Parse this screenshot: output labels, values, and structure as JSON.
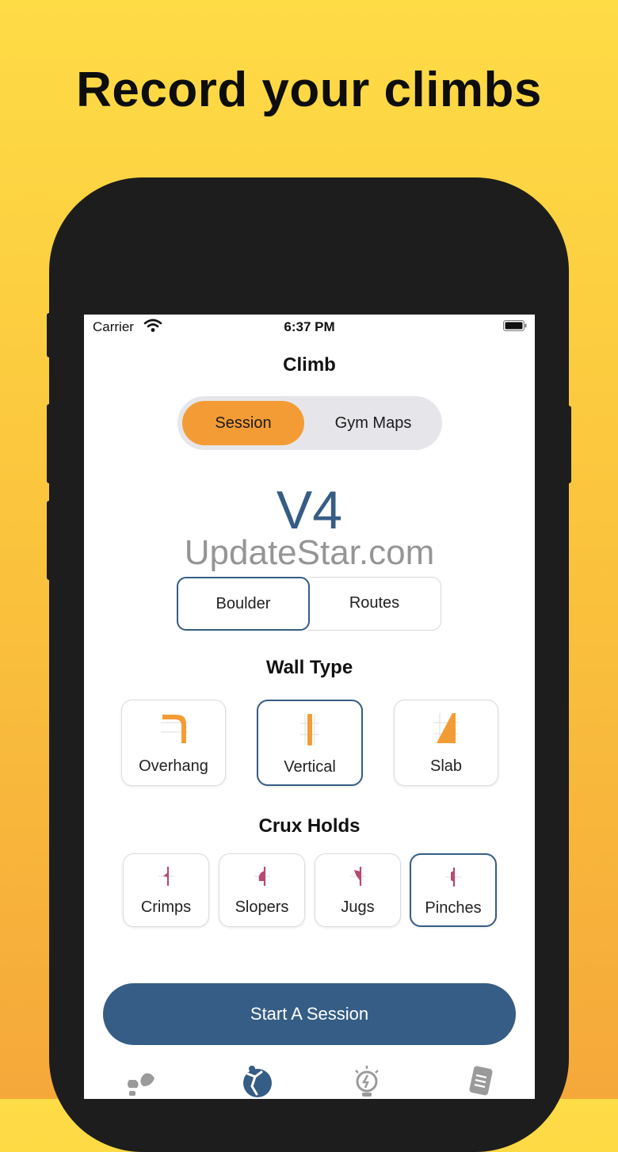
{
  "headline": "Record your climbs",
  "status_bar": {
    "carrier": "Carrier",
    "time": "6:37 PM"
  },
  "nav": {
    "title": "Climb"
  },
  "segment": {
    "options": [
      "Session",
      "Gym Maps"
    ],
    "selected": "Session"
  },
  "grade": "V4",
  "watermark": "UpdateStar.com",
  "climb_type": {
    "options": [
      "Boulder",
      "Routes"
    ],
    "selected": "Boulder"
  },
  "wall_type": {
    "title": "Wall Type",
    "options": [
      {
        "label": "Overhang",
        "icon": "overhang-icon"
      },
      {
        "label": "Vertical",
        "icon": "vertical-wall-icon"
      },
      {
        "label": "Slab",
        "icon": "slab-icon"
      }
    ],
    "selected": "Vertical"
  },
  "crux_holds": {
    "title": "Crux Holds",
    "options": [
      {
        "label": "Crimps",
        "icon": "crimp-icon"
      },
      {
        "label": "Slopers",
        "icon": "sloper-icon"
      },
      {
        "label": "Jugs",
        "icon": "jug-icon"
      },
      {
        "label": "Pinches",
        "icon": "pinch-icon"
      }
    ],
    "selected": "Pinches"
  },
  "cta": {
    "label": "Start A Session"
  },
  "tab_bar": {
    "icons": [
      "footprints-icon",
      "climber-icon",
      "lightbulb-icon",
      "notes-icon"
    ]
  },
  "colors": {
    "background_top": "#fedc46",
    "background_bottom": "#f5a83a",
    "accent_orange": "#f39c35",
    "primary_blue": "#355d85",
    "hold_pink": "#b84a6e"
  }
}
